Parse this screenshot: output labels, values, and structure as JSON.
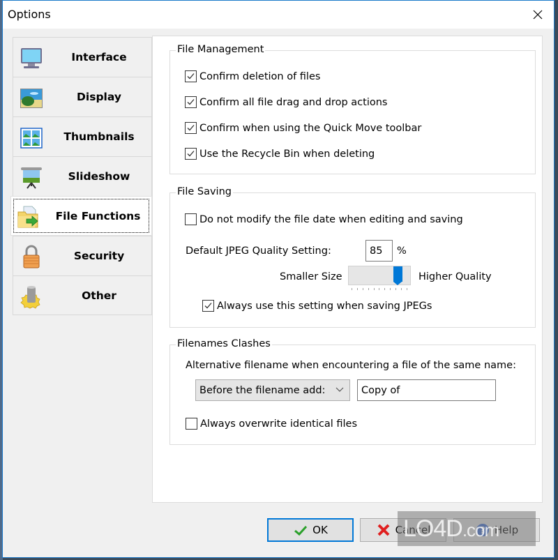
{
  "window": {
    "title": "Options"
  },
  "nav": {
    "items": [
      {
        "label": "Interface",
        "icon": "monitor-icon"
      },
      {
        "label": "Display",
        "icon": "landscape-picture-icon"
      },
      {
        "label": "Thumbnails",
        "icon": "thumbnails-grid-icon"
      },
      {
        "label": "Slideshow",
        "icon": "projector-screen-icon"
      },
      {
        "label": "File Functions",
        "icon": "folder-arrow-icon",
        "active": true
      },
      {
        "label": "Security",
        "icon": "padlock-icon"
      },
      {
        "label": "Other",
        "icon": "gear-cylinder-icon"
      }
    ]
  },
  "file_management": {
    "title": "File Management",
    "options": [
      {
        "label": "Confirm deletion of files",
        "checked": true
      },
      {
        "label": "Confirm all file drag and drop actions",
        "checked": true
      },
      {
        "label": "Confirm when using the Quick Move toolbar",
        "checked": true
      },
      {
        "label": "Use the Recycle Bin when deleting",
        "checked": true
      }
    ]
  },
  "file_saving": {
    "title": "File Saving",
    "no_modify_date": {
      "label": "Do not modify the file date when editing and saving",
      "checked": false
    },
    "jpeg_quality_label": "Default JPEG Quality Setting:",
    "jpeg_quality_value": "85",
    "jpeg_quality_unit": "%",
    "slider_min_label": "Smaller Size",
    "slider_max_label": "Higher Quality",
    "slider_value_percent": 85,
    "always_use": {
      "label": "Always use this setting when saving JPEGs",
      "checked": true
    }
  },
  "filename_clashes": {
    "title": "Filenames Clashes",
    "description": "Alternative filename when encountering a file of the same name:",
    "mode_selected": "Before the filename add:",
    "prefix_value": "Copy of",
    "always_overwrite": {
      "label": "Always overwrite identical files",
      "checked": false
    }
  },
  "buttons": {
    "ok": "OK",
    "cancel": "Cancel",
    "help": "Help"
  },
  "watermark": {
    "brand": "LO4D",
    "suffix": ".com"
  }
}
